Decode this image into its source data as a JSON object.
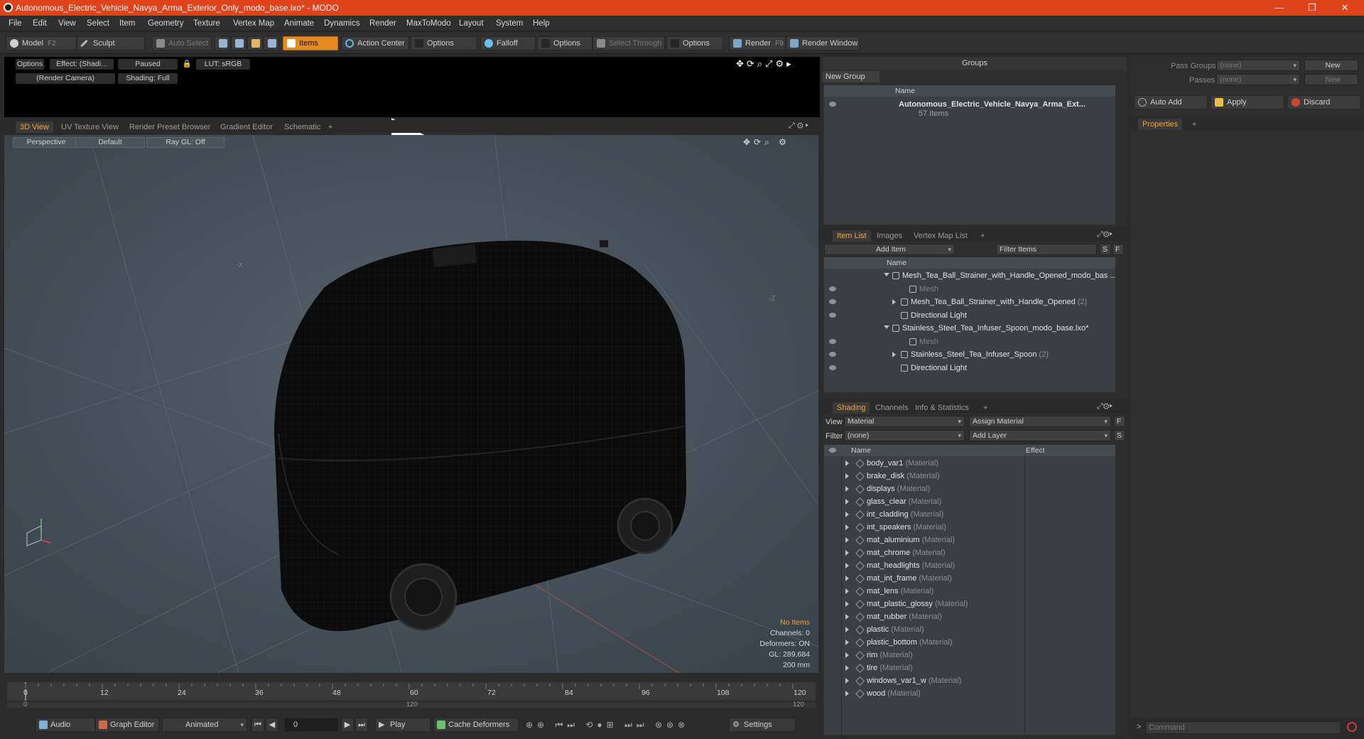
{
  "window": {
    "title": "Autonomous_Electric_Vehicle_Navya_Arma_Exterior_Only_modo_base.lxo* - MODO",
    "minimize": "—",
    "maximize": "❐",
    "close": "✕"
  },
  "menu": [
    "File",
    "Edit",
    "View",
    "Select",
    "Item",
    "Geometry",
    "Texture",
    "Vertex Map",
    "Animate",
    "Dynamics",
    "Render",
    "MaxToModo",
    "Layout",
    "System",
    "Help"
  ],
  "toolbar": {
    "model": "Model",
    "model_key": "F2",
    "sculpt": "Sculpt",
    "auto_select": "Auto Select",
    "items": "Items",
    "action_center": "Action Center",
    "options1": "Options",
    "falloff": "Falloff",
    "options2": "Options",
    "select_through": "Select Through",
    "options3": "Options",
    "render": "Render",
    "render_key": "F9",
    "render_window": "Render Window"
  },
  "render_preview": {
    "options": "Options",
    "effect": "Effect: (Shadi...",
    "paused": "Paused",
    "lut": "LUT: sRGB",
    "camera": "(Render Camera)",
    "shading": "Shading: Full"
  },
  "view_tabs": [
    "3D View",
    "UV Texture View",
    "Render Preset Browser",
    "Gradient Editor",
    "Schematic",
    "+"
  ],
  "viewport": {
    "perspective": "Perspective",
    "default": "Default",
    "raygl": "Ray GL: Off",
    "axis_x": "-X",
    "axis_z": "-Z",
    "stats": {
      "items": "No Items",
      "channels": "Channels: 0",
      "deformers": "Deformers: ON",
      "gl": "GL: 289,684",
      "scale": "200 mm"
    }
  },
  "timeline": {
    "ticks": [
      "0",
      "12",
      "24",
      "36",
      "48",
      "60",
      "72",
      "84",
      "96",
      "108",
      "120"
    ],
    "range_start": "0",
    "range_mid": "120",
    "range_end": "120"
  },
  "bottombar": {
    "audio": "Audio",
    "graph_editor": "Graph Editor",
    "animated": "Animated",
    "frame": "0",
    "play": "Play",
    "cache_deformers": "Cache Deformers",
    "settings": "Settings"
  },
  "groups": {
    "title": "Groups",
    "new_group": "New Group",
    "col_name": "Name",
    "item_name": "Autonomous_Electric_Vehicle_Navya_Arma_Ext...",
    "item_count": "57 Items"
  },
  "passes": {
    "pass_groups_label": "Pass Groups",
    "pass_groups_value": "(none)",
    "passes_label": "Passes",
    "passes_value": "(none)",
    "new1": "New",
    "new2": "New"
  },
  "actions": {
    "auto_add": "Auto Add",
    "apply": "Apply",
    "discard": "Discard"
  },
  "properties": {
    "tab": "Properties",
    "plus": "+"
  },
  "item_panel": {
    "tabs": [
      "Item List",
      "Images",
      "Vertex Map List",
      "+"
    ],
    "add_item": "Add Item",
    "filter": "Filter Items",
    "s": "S",
    "f": "F",
    "col_name": "Name",
    "rows": [
      {
        "label": "Mesh_Tea_Ball_Strainer_with_Handle_Opened_modo_bas ...",
        "sub": "",
        "indent": 0,
        "arrow": "dn"
      },
      {
        "label": "Mesh",
        "sub": "",
        "indent": 2,
        "arrow": "",
        "dim": true
      },
      {
        "label": "Mesh_Tea_Ball_Strainer_with_Handle_Opened",
        "sub": "(2)",
        "indent": 1,
        "arrow": "rt"
      },
      {
        "label": "Directional Light",
        "sub": "",
        "indent": 1,
        "arrow": ""
      },
      {
        "label": "Stainless_Steel_Tea_Infuser_Spoon_modo_base.lxo*",
        "sub": "",
        "indent": 0,
        "arrow": "dn"
      },
      {
        "label": "Mesh",
        "sub": "",
        "indent": 2,
        "arrow": "",
        "dim": true
      },
      {
        "label": "Stainless_Steel_Tea_Infuser_Spoon",
        "sub": "(2)",
        "indent": 1,
        "arrow": "rt"
      },
      {
        "label": "Directional Light",
        "sub": "",
        "indent": 1,
        "arrow": ""
      }
    ]
  },
  "shading": {
    "tabs": [
      "Shading",
      "Channels",
      "Info & Statistics",
      "+"
    ],
    "view_label": "View",
    "view_value": "Material",
    "assign": "Assign Material",
    "filter_label": "Filter",
    "filter_value": "(none)",
    "add_layer": "Add Layer",
    "f": "F",
    "s": "S",
    "col_name": "Name",
    "col_effect": "Effect",
    "suffix": "(Material)",
    "materials": [
      "body_var1",
      "brake_disk",
      "displays",
      "glass_clear",
      "int_cladding",
      "int_speakers",
      "mat_aluminium",
      "mat_chrome",
      "mat_headlights",
      "mat_int_frame",
      "mat_lens",
      "mat_plastic_glossy",
      "mat_rubber",
      "plastic",
      "plastic_bottom",
      "rim",
      "tire",
      "windows_var1_w",
      "wood"
    ]
  },
  "command": {
    "placeholder": "Command",
    "prompt": ">"
  },
  "colors": {
    "accent": "#e58a21",
    "titlebar": "#e0421a",
    "viewport": "#3e474d",
    "list_bg": "#3b3f44"
  }
}
